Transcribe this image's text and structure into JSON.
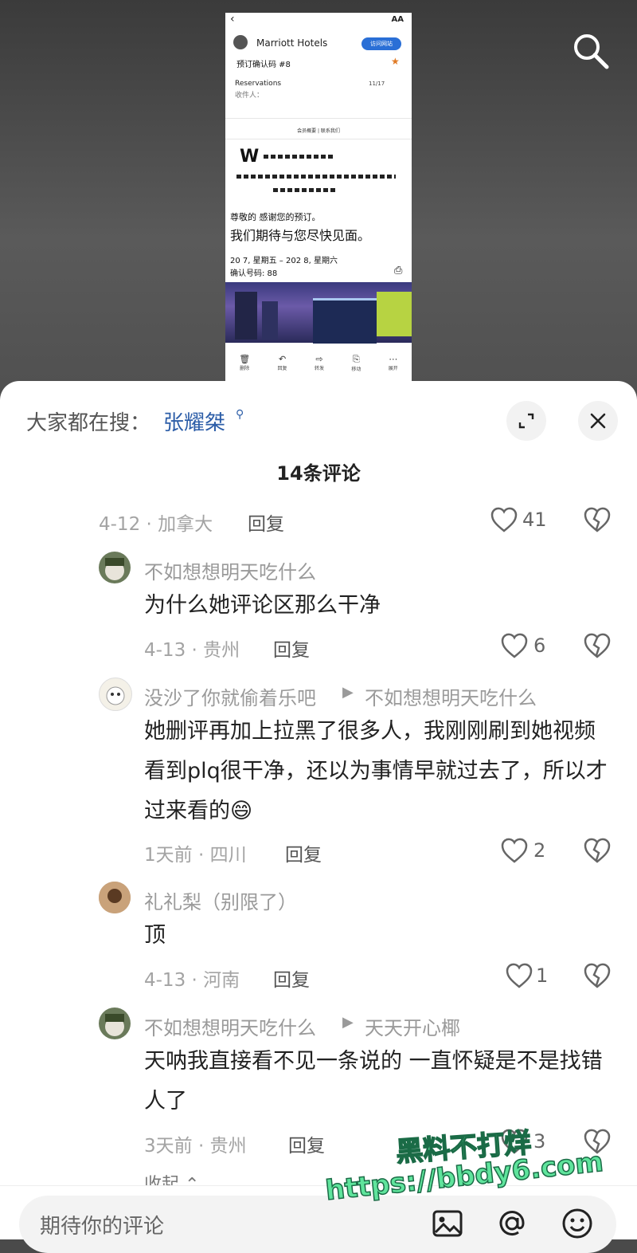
{
  "email": {
    "brand": "Marriott Hotels",
    "visit_button": "访问网站",
    "subject": "预订确认码 #8",
    "sender": "Reservations",
    "date": "11/17",
    "recipient": "收件人：",
    "links": "会员概要 | 联系我们",
    "hotel_logo": "W",
    "greeting": "尊敬的 感谢您的预订。",
    "headline": "我们期待与您尽快见面。",
    "stay_dates": "20 7, 星期五 – 202 8, 星期六",
    "confirmation": "确认号码: 88",
    "toolbar": [
      {
        "icon": "trash-icon",
        "label": "删除"
      },
      {
        "icon": "reply-icon",
        "label": "回复"
      },
      {
        "icon": "forward-icon",
        "label": "转发"
      },
      {
        "icon": "move-icon",
        "label": "移动"
      },
      {
        "icon": "more-icon",
        "label": "展开"
      }
    ]
  },
  "trending": {
    "label": "大家都在搜：",
    "term": "张耀桀"
  },
  "comments_count": "14条评论",
  "top_meta": {
    "time_loc": "4-12 · 加拿大",
    "reply": "回复",
    "likes": "41"
  },
  "comments": [
    {
      "name": "不如想想明天吃什么",
      "target": "",
      "text": "为什么她评论区那么干净",
      "time_loc": "4-13 · 贵州",
      "reply": "回复",
      "likes": "6"
    },
    {
      "name": "没沙了你就偷着乐吧",
      "target": "不如想想明天吃什么",
      "text": "她删评再加上拉黑了很多人，我刚刚刷到她视频看到plq很干净，还以为事情早就过去了，所以才过来看的😄",
      "time_loc": "1天前 · 四川",
      "reply": "回复",
      "likes": "2"
    },
    {
      "name": "礼礼梨（别限了）",
      "target": "",
      "text": "顶",
      "time_loc": "4-13 · 河南",
      "reply": "回复",
      "likes": "1"
    },
    {
      "name": "不如想想明天吃什么",
      "target": "天天开心椰",
      "text": "天呐我直接看不见一条说的 一直怀疑是不是找错人了",
      "time_loc": "3天前 · 贵州",
      "reply": "回复",
      "likes": "3"
    }
  ],
  "collapse": "收起 ⌃",
  "input_placeholder": "期待你的评论",
  "watermark": {
    "line1": "黑料不打烊",
    "line2": "https://bbdy6.com"
  }
}
